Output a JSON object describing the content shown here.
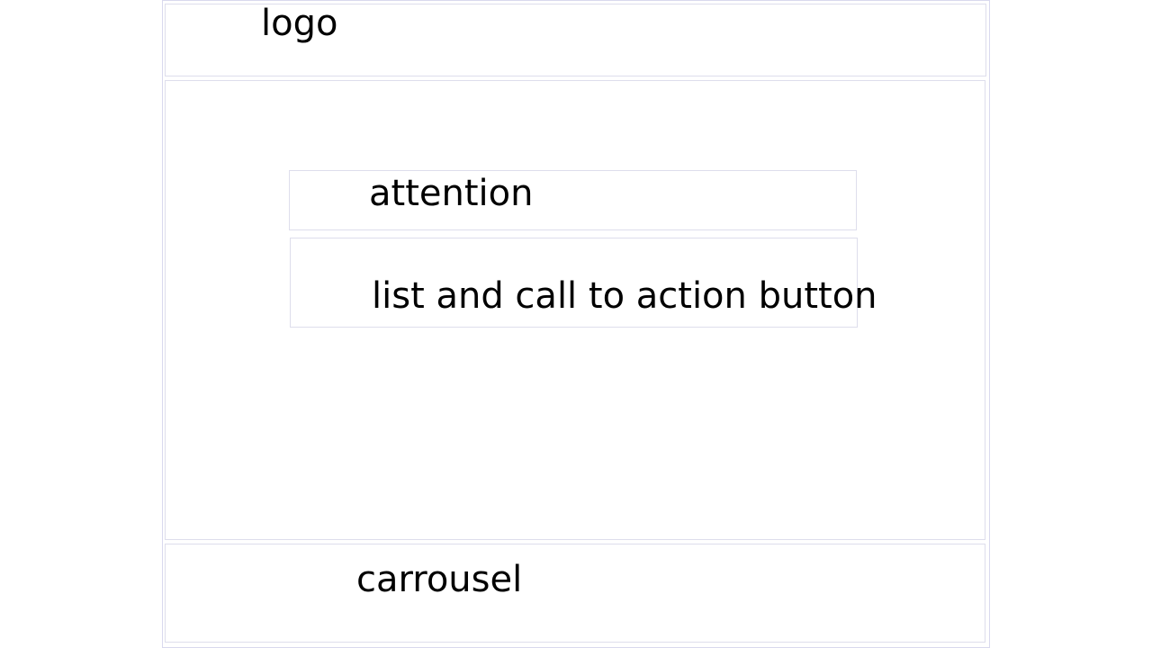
{
  "header": {
    "logo_label": "logo"
  },
  "main": {
    "attention_label": "attention",
    "cta_label": "list and call to action button"
  },
  "carousel": {
    "label": "carrousel"
  },
  "colors": {
    "border": "#dedeec",
    "frame_border": "#d9d9ee",
    "text": "#000000",
    "background": "#ffffff"
  }
}
